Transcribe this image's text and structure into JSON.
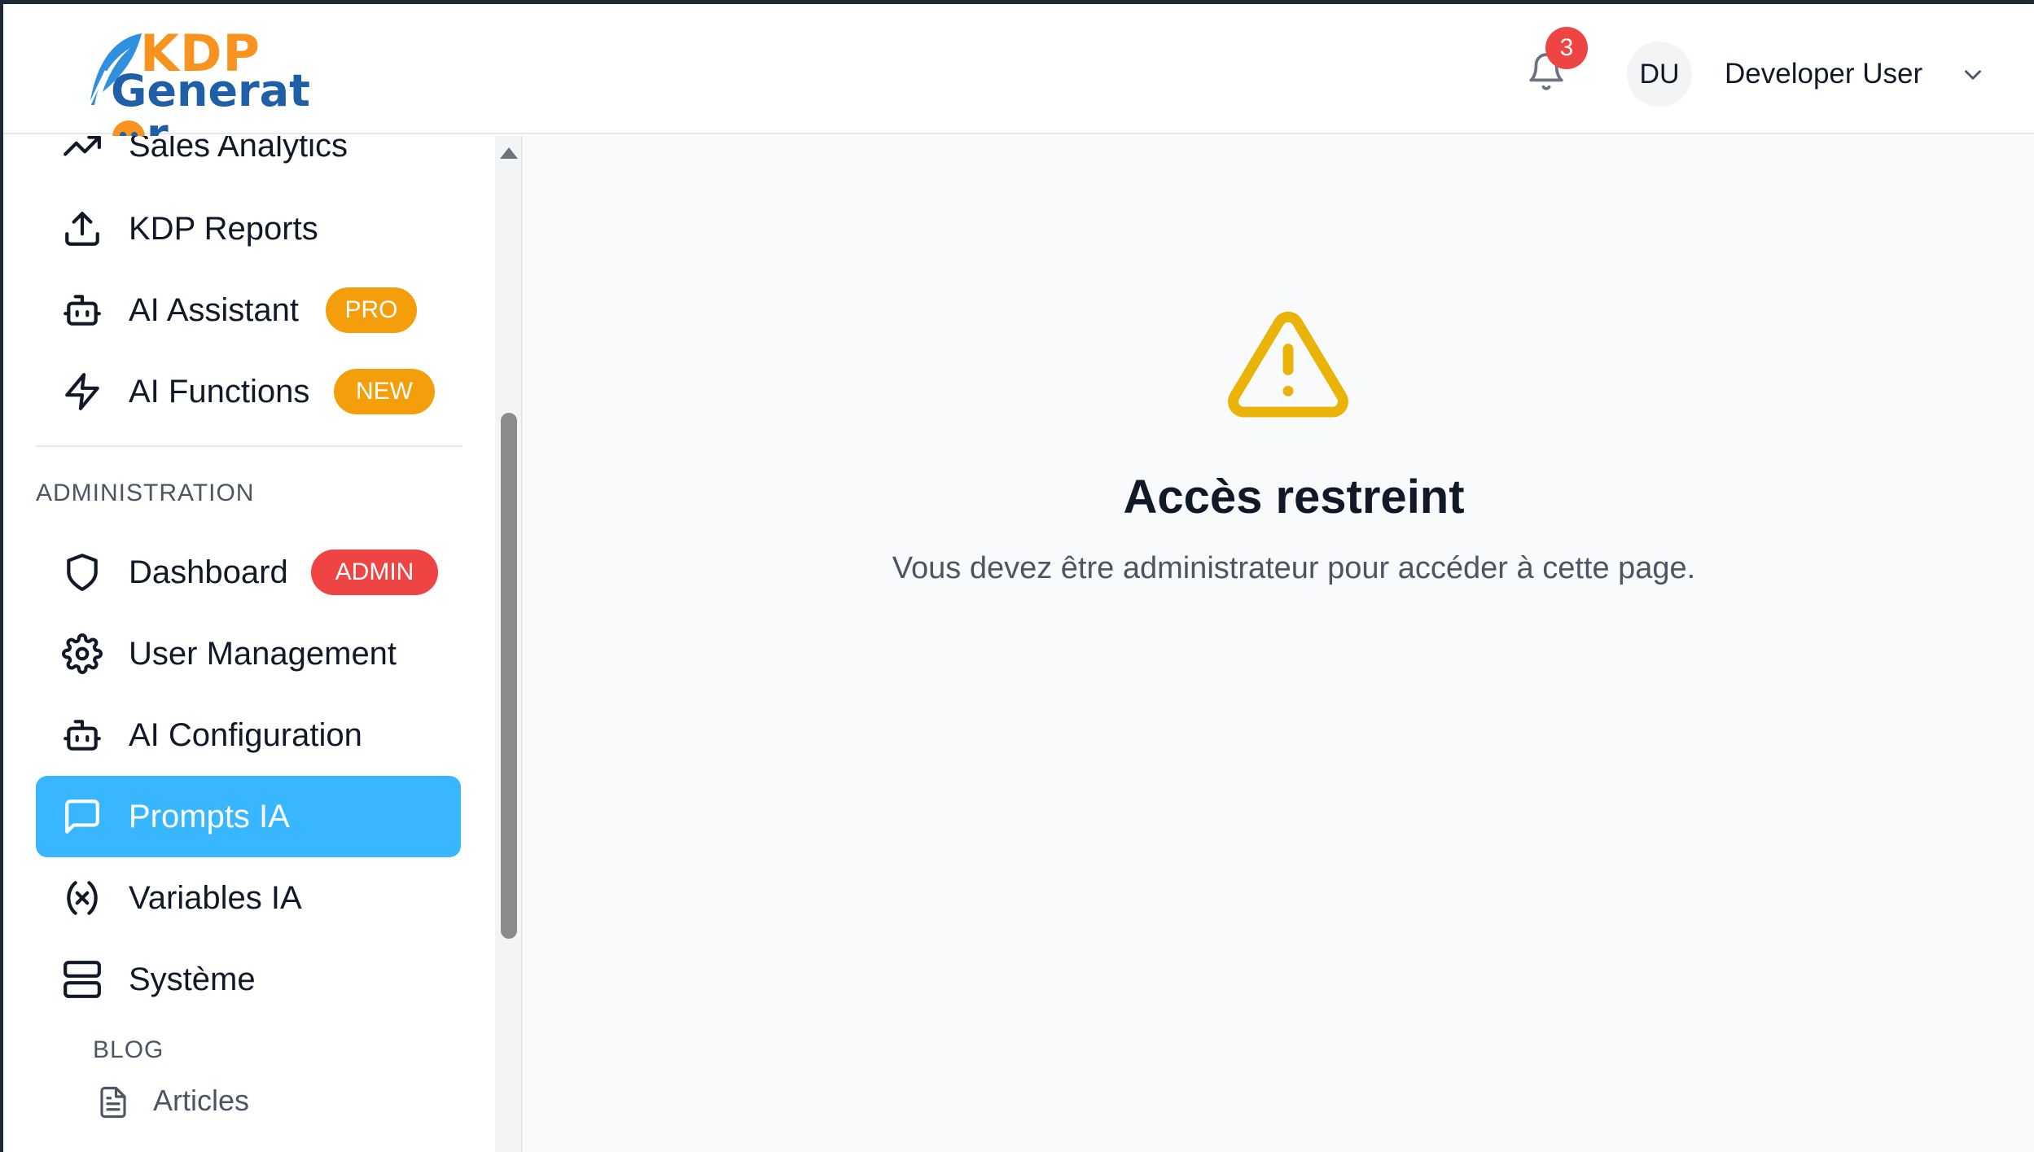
{
  "app": {
    "logo_line1": "KDP",
    "logo_line2": "Generat",
    "logo_line2_end": "r"
  },
  "header": {
    "notifications_count": "3",
    "avatar_initials": "DU",
    "user_name": "Developer User"
  },
  "sidebar": {
    "items_top": [
      {
        "label": "Sales Analytics",
        "icon": "trending-up-icon"
      },
      {
        "label": "KDP Reports",
        "icon": "upload-icon"
      },
      {
        "label": "AI Assistant",
        "icon": "bot-icon",
        "badge": "PRO"
      },
      {
        "label": "AI Functions",
        "icon": "zap-icon",
        "badge": "NEW"
      }
    ],
    "admin_section_title": "ADMINISTRATION",
    "admin_items": [
      {
        "label": "Dashboard",
        "icon": "shield-icon",
        "badge": "ADMIN"
      },
      {
        "label": "User Management",
        "icon": "gear-icon"
      },
      {
        "label": "AI Configuration",
        "icon": "bot-icon"
      },
      {
        "label": "Prompts IA",
        "icon": "message-square-icon",
        "active": true
      },
      {
        "label": "Variables IA",
        "icon": "variable-icon"
      },
      {
        "label": "Système",
        "icon": "server-icon"
      }
    ],
    "blog_section_title": "BLOG",
    "blog_items": [
      {
        "label": "Articles",
        "icon": "file-text-icon"
      }
    ]
  },
  "main": {
    "title": "Accès restreint",
    "message": "Vous devez être administrateur pour accéder à cette page.",
    "icon": "warning-triangle-icon"
  },
  "colors": {
    "accent": "#38b6ff",
    "badge_orange": "#f59e0b",
    "badge_red": "#ef4444",
    "warning": "#eab308",
    "logo_orange": "#f7931e",
    "logo_blue": "#1f5fa8"
  }
}
